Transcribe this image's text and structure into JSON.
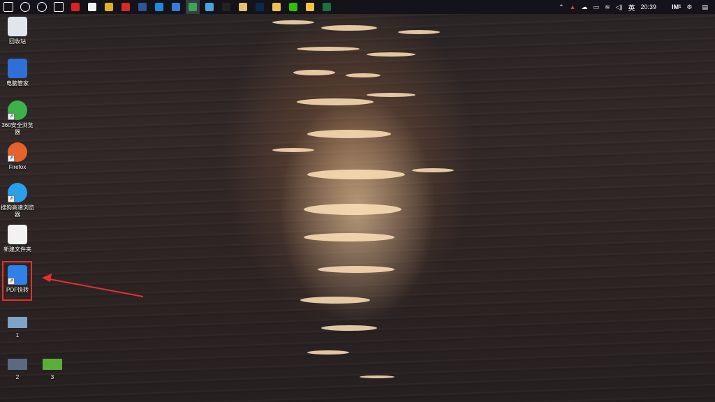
{
  "taskbar": {
    "pinned_icons": [
      {
        "name": "start-icon",
        "color": "#ffffff"
      },
      {
        "name": "search-icon",
        "color": "#ffffff"
      },
      {
        "name": "cortana-icon",
        "color": "#ffffff"
      },
      {
        "name": "task-view-icon",
        "color": "#ffffff"
      },
      {
        "name": "app-red-icon",
        "color": "#e02020"
      },
      {
        "name": "notepad-icon",
        "color": "#f2f2f2"
      },
      {
        "name": "app-yellow-icon",
        "color": "#e0b020"
      },
      {
        "name": "netease-music-icon",
        "color": "#d62a2a"
      },
      {
        "name": "word-icon",
        "color": "#2b5797"
      },
      {
        "name": "edge-icon",
        "color": "#1e88e5"
      },
      {
        "name": "app-blue-icon",
        "color": "#3a7bd5"
      },
      {
        "name": "chrome-icon",
        "color": "#34a853"
      },
      {
        "name": "app-light-blue-icon",
        "color": "#4aa3df"
      },
      {
        "name": "qq-icon",
        "color": "#222222"
      },
      {
        "name": "app-image-icon",
        "color": "#e8c070"
      },
      {
        "name": "photoshop-icon",
        "color": "#0a2a4a"
      },
      {
        "name": "app-emoji-icon",
        "color": "#f0c050"
      },
      {
        "name": "wechat-icon",
        "color": "#2dc100"
      },
      {
        "name": "file-explorer-icon",
        "color": "#f5c542"
      },
      {
        "name": "excel-icon",
        "color": "#1d7044"
      }
    ],
    "active_index": 11,
    "tray": {
      "language": "英",
      "time": "20:39",
      "tray_badge": "1"
    }
  },
  "desktop_icons": [
    {
      "id": "recycle-bin",
      "label": "回收站",
      "color": "#dfe6ee",
      "shortcut": false
    },
    {
      "id": "pc-manager",
      "label": "电脑管家",
      "color": "#2f6fd6",
      "shortcut": false
    },
    {
      "id": "browser-360",
      "label": "360安全浏览器",
      "color": "#3eb24a",
      "shortcut": true
    },
    {
      "id": "firefox",
      "label": "Firefox",
      "color": "#e8602c",
      "shortcut": true
    },
    {
      "id": "sogou-browser",
      "label": "搜狗高速浏览器",
      "color": "#2aa0e8",
      "shortcut": true
    },
    {
      "id": "new-folder",
      "label": "新建文件夹",
      "color": "#f2f2f2",
      "shortcut": false
    },
    {
      "id": "pdf-converter",
      "label": "PDF快转",
      "color": "#2f80e8",
      "shortcut": true
    },
    {
      "id": "file-1",
      "label": "1",
      "color": "#7fa3c8",
      "shortcut": false
    },
    {
      "id": "file-2",
      "label": "2",
      "color": "#5a6a80",
      "shortcut": false
    },
    {
      "id": "file-3",
      "label": "3",
      "color": "#5cae3a",
      "shortcut": false
    }
  ]
}
